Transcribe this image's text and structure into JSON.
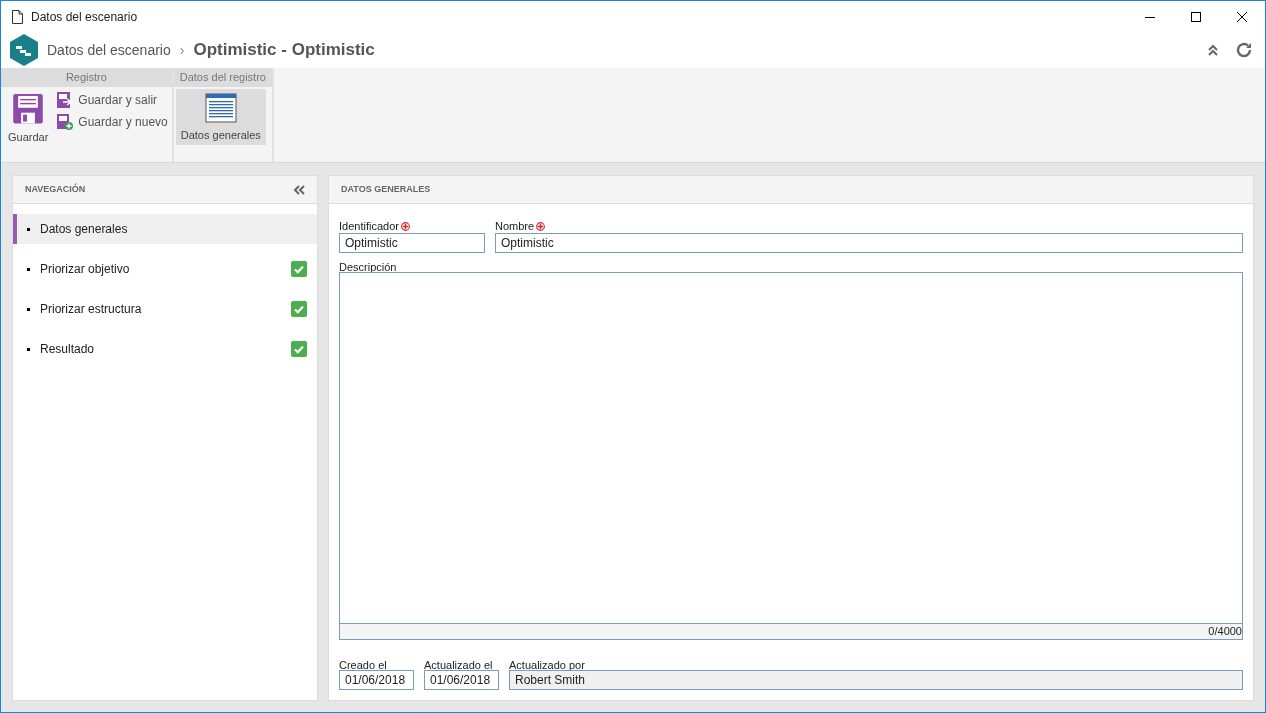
{
  "window": {
    "title": "Datos del escenario"
  },
  "header": {
    "breadcrumb": "Datos del escenario",
    "separator": "›",
    "title": "Optimistic - Optimistic"
  },
  "ribbon": [
    {
      "title": "Registro",
      "items": [
        {
          "kind": "large",
          "label": "Guardar"
        },
        {
          "kind": "small",
          "label": "Guardar y salir"
        },
        {
          "kind": "small",
          "label": "Guardar y nuevo"
        }
      ]
    },
    {
      "title": "Datos del registro",
      "items": [
        {
          "kind": "large",
          "label": "Datos generales",
          "selected": true
        }
      ]
    }
  ],
  "navigation": {
    "title": "NAVEGACIÓN",
    "items": [
      {
        "label": "Datos generales",
        "selected": true,
        "done": false
      },
      {
        "label": "Priorizar objetivo",
        "selected": false,
        "done": true
      },
      {
        "label": "Priorizar estructura",
        "selected": false,
        "done": true
      },
      {
        "label": "Resultado",
        "selected": false,
        "done": true
      }
    ]
  },
  "panel": {
    "title": "DATOS GENERALES",
    "top_fields": [
      {
        "label": "Identificador",
        "required": true,
        "value": "Optimistic"
      },
      {
        "label": "Nombre",
        "required": true,
        "value": "Optimistic"
      }
    ],
    "description": {
      "label": "Descripción",
      "counter": "0/4000"
    },
    "bottom_fields": [
      {
        "label": "Creado el",
        "value": "01/06/2018",
        "disabled": false
      },
      {
        "label": "Actualizado el",
        "value": "01/06/2018",
        "disabled": false
      },
      {
        "label": "Actualizado por",
        "value": "Robert Smith",
        "disabled": true
      }
    ]
  }
}
